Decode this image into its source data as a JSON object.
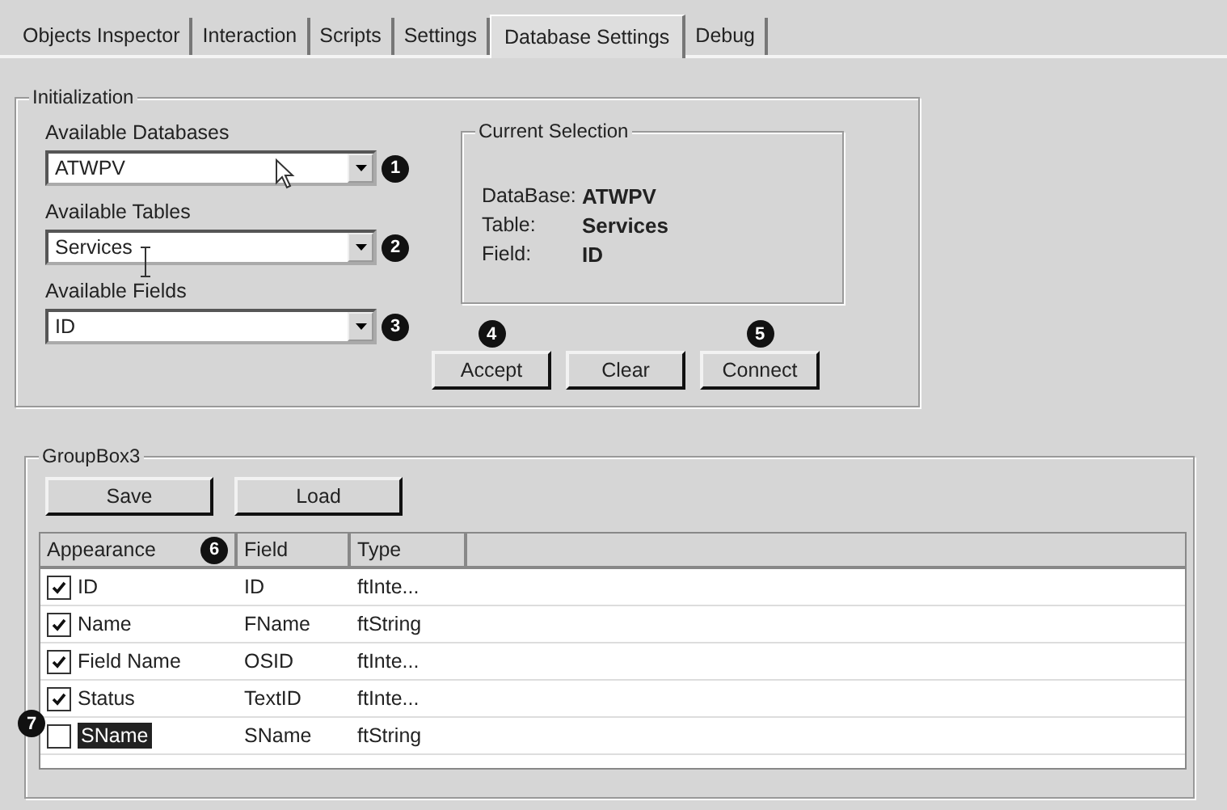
{
  "tabs": [
    {
      "label": "Objects Inspector",
      "selected": false
    },
    {
      "label": "Interaction",
      "selected": false
    },
    {
      "label": "Scripts",
      "selected": false
    },
    {
      "label": "Settings",
      "selected": false
    },
    {
      "label": "Database Settings",
      "selected": true
    },
    {
      "label": "Debug",
      "selected": false
    }
  ],
  "initialization": {
    "title": "Initialization",
    "combos": [
      {
        "label": "Available Databases",
        "value": "ATWPV",
        "callout": "1"
      },
      {
        "label": "Available Tables",
        "value": "Services",
        "callout": "2"
      },
      {
        "label": "Available Fields",
        "value": "ID",
        "callout": "3"
      }
    ],
    "current_selection": {
      "title": "Current Selection",
      "rows": [
        {
          "label": "DataBase:",
          "value": "ATWPV"
        },
        {
          "label": "Table:",
          "value": "Services"
        },
        {
          "label": "Field:",
          "value": "ID"
        }
      ]
    },
    "buttons": [
      {
        "label": "Accept",
        "callout": "4"
      },
      {
        "label": "Clear"
      },
      {
        "label": "Connect",
        "callout": "5"
      }
    ]
  },
  "groupbox": {
    "title": "GroupBox3",
    "buttons": [
      "Save",
      "Load"
    ],
    "table": {
      "columns": [
        {
          "label": "Appearance",
          "callout": "6"
        },
        {
          "label": "Field"
        },
        {
          "label": "Type"
        }
      ],
      "rows": [
        {
          "appearance": "ID",
          "checked": true,
          "selected": false,
          "field": "ID",
          "type": "ftInte..."
        },
        {
          "appearance": "Name",
          "checked": true,
          "selected": false,
          "field": "FName",
          "type": "ftString"
        },
        {
          "appearance": "Field Name",
          "checked": true,
          "selected": false,
          "field": "OSID",
          "type": "ftInte..."
        },
        {
          "appearance": "Status",
          "checked": true,
          "selected": false,
          "field": "TextID",
          "type": "ftInte..."
        },
        {
          "appearance": "SName",
          "checked": false,
          "selected": true,
          "field": "SName",
          "type": "ftString",
          "callout": "7"
        }
      ]
    }
  }
}
